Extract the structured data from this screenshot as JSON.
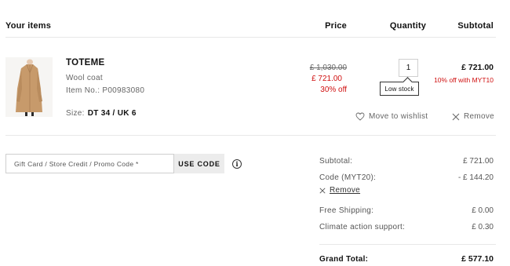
{
  "header": {
    "items": "Your items",
    "price": "Price",
    "quantity": "Quantity",
    "subtotal": "Subtotal"
  },
  "item": {
    "brand": "TOTEME",
    "name": "Wool coat",
    "item_no": "Item No.: P00983080",
    "size_label": "Size:",
    "size_value": "DT 34 / UK 6",
    "old_price": "£ 1,030.00",
    "new_price": "£ 721.00",
    "discount": "30% off",
    "quantity": "1",
    "stock_tooltip": "Low stock",
    "subtotal": "£ 721.00",
    "subtotal_note": "10% off with MYT10",
    "move_to_wishlist": "Move to wishlist",
    "remove": "Remove",
    "image_icon": "wool-coat-image"
  },
  "promo": {
    "placeholder": "Gift Card / Store Credit / Promo Code *",
    "button": "USE CODE",
    "info_icon": "i"
  },
  "summary": {
    "subtotal_label": "Subtotal:",
    "subtotal_value": "£ 721.00",
    "code_label": "Code (MYT20):",
    "code_value": "- £ 144.20",
    "code_remove": "Remove",
    "shipping_label": "Free Shipping:",
    "shipping_value": "£ 0.00",
    "climate_label": "Climate action support:",
    "climate_value": "£ 0.30",
    "grand_label": "Grand Total:",
    "grand_value": "£ 577.10"
  },
  "colors": {
    "accent_red": "#d01010",
    "coat": "#c79a6b"
  }
}
